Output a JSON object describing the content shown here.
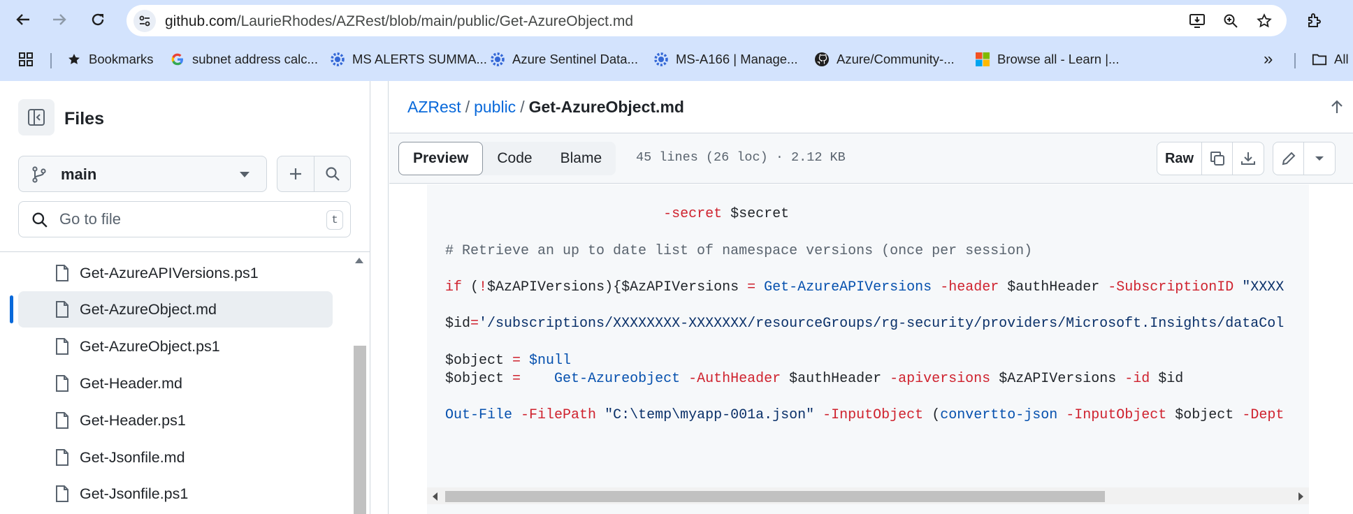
{
  "browser": {
    "url_host": "github.com",
    "url_path": "/LaurieRhodes/AZRest/blob/main/public/Get-AzureObject.md",
    "bookmarks": [
      {
        "label": "Bookmarks",
        "icon": "star-icon"
      },
      {
        "label": "subnet address calc...",
        "icon": "google-icon"
      },
      {
        "label": "MS ALERTS SUMMA...",
        "icon": "azure-gear-icon"
      },
      {
        "label": "Azure Sentinel Data...",
        "icon": "azure-gear-icon"
      },
      {
        "label": "MS-A166 | Manage...",
        "icon": "azure-gear-icon"
      },
      {
        "label": "Azure/Community-...",
        "icon": "github-icon"
      },
      {
        "label": "Browse all - Learn |...",
        "icon": "microsoft-icon"
      }
    ],
    "overflow_label": "»",
    "all_bookmarks_label": "All"
  },
  "sidebar": {
    "title": "Files",
    "branch": "main",
    "goto_placeholder": "Go to file",
    "goto_shortcut": "t",
    "files": [
      {
        "name": "Get-AzureAPIVersions.ps1",
        "active": false
      },
      {
        "name": "Get-AzureObject.md",
        "active": true
      },
      {
        "name": "Get-AzureObject.ps1",
        "active": false
      },
      {
        "name": "Get-Header.md",
        "active": false
      },
      {
        "name": "Get-Header.ps1",
        "active": false
      },
      {
        "name": "Get-Jsonfile.md",
        "active": false
      },
      {
        "name": "Get-Jsonfile.ps1",
        "active": false
      }
    ]
  },
  "main": {
    "breadcrumb": {
      "repo": "AZRest",
      "folder": "public",
      "file": "Get-AzureObject.md",
      "sep": "/"
    },
    "tabs": {
      "preview": "Preview",
      "code": "Code",
      "blame": "Blame"
    },
    "file_meta": "45 lines (26 loc) · 2.12 KB",
    "raw_label": "Raw",
    "code_lines": [
      "                          -secret $secret",
      "",
      "# Retrieve an up to date list of namespace versions (once per session)",
      "",
      "if (!$AzAPIVersions){$AzAPIVersions = Get-AzureAPIVersions -header $authHeader -SubscriptionID \"XXXX",
      "",
      "$id='/subscriptions/XXXXXXXX-XXXXXXX/resourceGroups/rg-security/providers/Microsoft.Insights/dataCol",
      "",
      "$object = $null",
      "$object =    Get-Azureobject -AuthHeader $authHeader -apiversions $AzAPIVersions -id $id",
      "",
      "Out-File -FilePath \"C:\\temp\\myapp-001a.json\" -InputObject (convertto-json -InputObject $object -Dept"
    ]
  }
}
